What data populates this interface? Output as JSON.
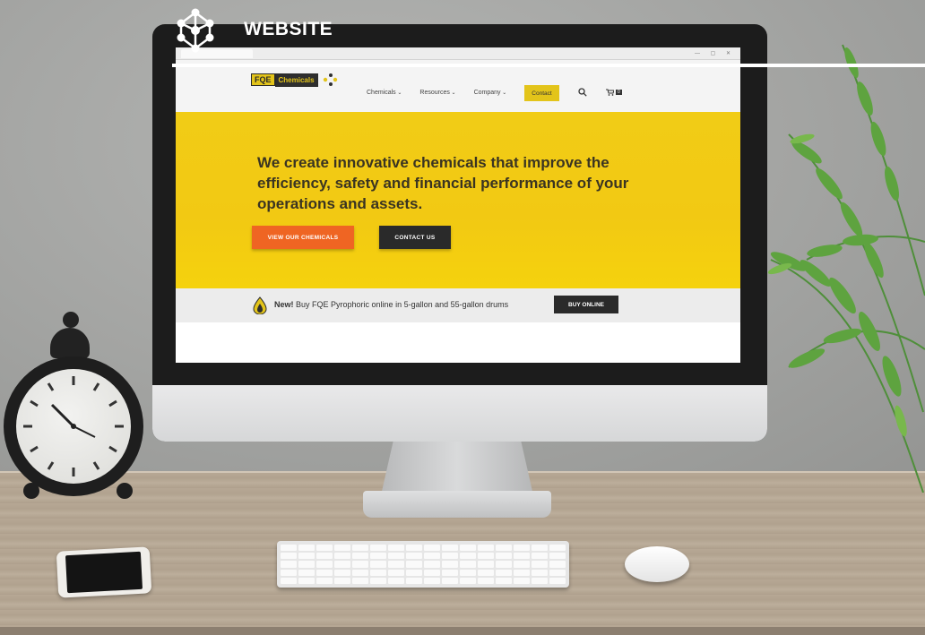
{
  "header": {
    "title": "WEBSITE",
    "icon": "molecule-network-icon"
  },
  "browser": {
    "controls": "— ▢ ✕"
  },
  "site": {
    "logo": {
      "fqe": "FQE",
      "chemicals": "Chemicals"
    },
    "nav": {
      "items": [
        "Chemicals",
        "Resources",
        "Company"
      ],
      "contact": "Contact",
      "cart_count": "0"
    },
    "hero": {
      "headline": "We create innovative chemicals that improve the efficiency, safety and financial performance of your operations and assets.",
      "primary_button": "VIEW OUR CHEMICALS",
      "secondary_button": "CONTACT US"
    },
    "promo": {
      "new_label": "New!",
      "text": " Buy FQE Pyrophoric online in 5-gallon and 55-gallon drums",
      "button": "BUY ONLINE"
    }
  },
  "colors": {
    "accent_yellow": "#f1cc16",
    "accent_orange": "#ef6523",
    "dark": "#2a2a2a"
  }
}
